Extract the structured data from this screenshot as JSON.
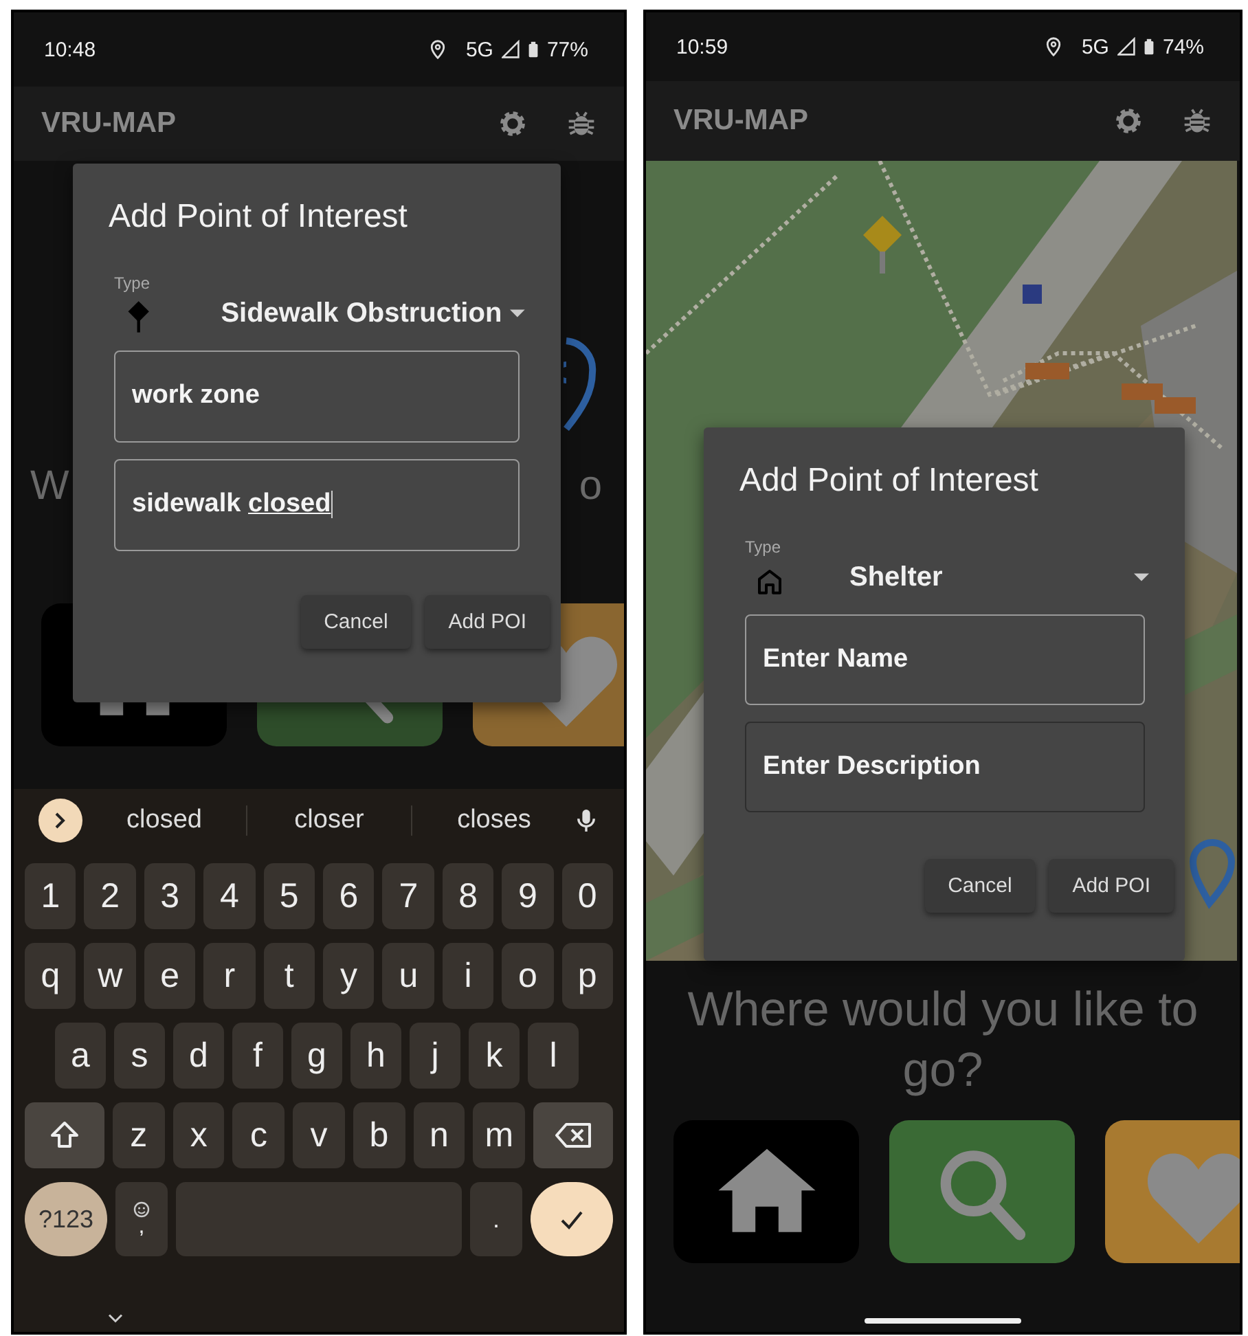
{
  "screens": [
    {
      "status_bar": {
        "time": "10:48",
        "network": "5G",
        "battery": "77%"
      },
      "app_bar": {
        "title": "VRU-MAP"
      },
      "background": {
        "kind": "blank",
        "heading_fragments": [
          "W",
          "o"
        ]
      },
      "tiles": [
        {
          "kind": "home",
          "color": "#000000"
        },
        {
          "kind": "search",
          "color": "#2e4d2a"
        },
        {
          "kind": "favorite",
          "color": "#8a6630"
        }
      ],
      "dialog": {
        "title": "Add Point of Interest",
        "type_label": "Type",
        "type_icon": {
          "kind": "signpost"
        },
        "type_value": "Sidewalk Obstruction",
        "fields": [
          {
            "value": "work zone"
          },
          {
            "value": "sidewalk ",
            "composing": "closed"
          }
        ],
        "buttons": [
          "Cancel",
          "Add POI"
        ]
      },
      "keyboard": {
        "suggestions": [
          "closed",
          "closer",
          "closes"
        ],
        "rows": [
          [
            "1",
            "2",
            "3",
            "4",
            "5",
            "6",
            "7",
            "8",
            "9",
            "0"
          ],
          [
            "q",
            "w",
            "e",
            "r",
            "t",
            "y",
            "u",
            "i",
            "o",
            "p"
          ],
          [
            "a",
            "s",
            "d",
            "f",
            "g",
            "h",
            "j",
            "k",
            "l"
          ],
          [
            "z",
            "x",
            "c",
            "v",
            "b",
            "n",
            "m"
          ]
        ],
        "mode_key": "?123",
        "comma_key": ",",
        "period_key": "."
      }
    },
    {
      "status_bar": {
        "time": "10:59",
        "network": "5G",
        "battery": "74%"
      },
      "app_bar": {
        "title": "VRU-MAP"
      },
      "background": {
        "kind": "map",
        "heading": "Where would you like to go?"
      },
      "tiles": [
        {
          "kind": "home",
          "color": "#000000"
        },
        {
          "kind": "search",
          "color": "#3a6a35"
        },
        {
          "kind": "favorite",
          "color": "#a87a30"
        }
      ],
      "dialog": {
        "title": "Add Point of Interest",
        "type_label": "Type",
        "type_icon": {
          "kind": "house"
        },
        "type_value": "Shelter",
        "fields": [
          {
            "placeholder": "Enter Name"
          },
          {
            "placeholder": "Enter Description"
          }
        ],
        "buttons": [
          "Cancel",
          "Add POI"
        ]
      }
    }
  ]
}
